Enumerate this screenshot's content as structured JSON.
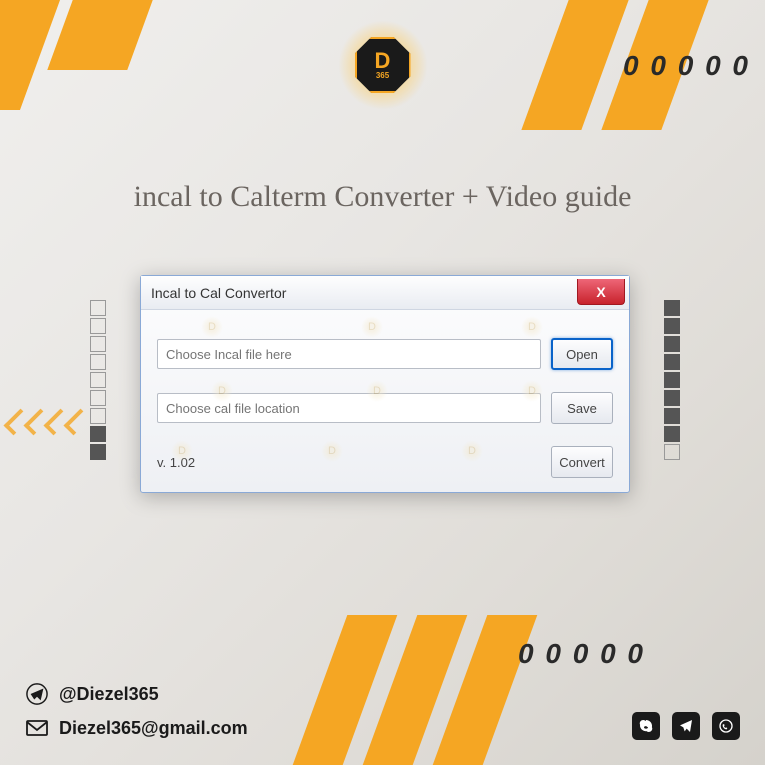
{
  "brand": {
    "letter": "D",
    "number": "365"
  },
  "headline": "incal to Calterm Converter + Video guide",
  "dots_sequence": "0 0 0 0 0",
  "dialog": {
    "title": "Incal to Cal Convertor",
    "input1_placeholder": "Choose Incal file here",
    "input2_placeholder": "Choose cal file location",
    "open_btn": "Open",
    "save_btn": "Save",
    "convert_btn": "Convert",
    "version": "v. 1.02",
    "close_label": "X"
  },
  "contacts": {
    "handle": "@Diezel365",
    "email": "Diezel365@gmail.com"
  },
  "side_boxes_left": [
    false,
    false,
    false,
    false,
    false,
    false,
    false,
    true,
    true
  ],
  "side_boxes_right": [
    true,
    true,
    true,
    true,
    true,
    true,
    true,
    true,
    false
  ]
}
